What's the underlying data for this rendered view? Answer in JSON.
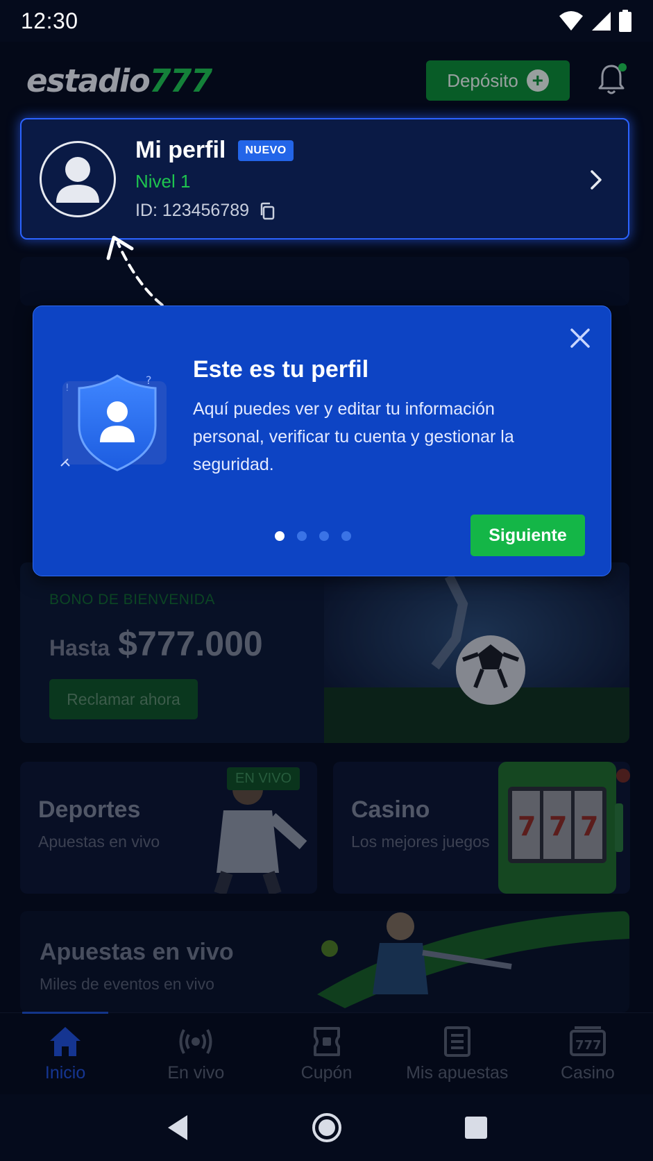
{
  "status_bar": {
    "time": "12:30"
  },
  "header": {
    "logo_text": "estadio",
    "logo_number": "777",
    "deposit_label": "Depósito"
  },
  "profile": {
    "name": "Mi perfil",
    "badge": "NUEVO",
    "level": "Nivel 1",
    "id_text": "ID: 123456789"
  },
  "tooltip": {
    "title": "Este es tu perfil",
    "body": "Aquí puedes ver y editar tu información personal, verificar tu cuenta y gestionar la seguridad.",
    "next_label": "Siguiente",
    "step_count": 4,
    "active_step": 1
  },
  "bono": {
    "label": "BONO DE BIENVENIDA",
    "prefix": "Hasta",
    "amount": "$777.000",
    "cta": "Reclamar ahora"
  },
  "tiles": {
    "sports": {
      "title": "Deportes",
      "subtitle": "Apuestas en vivo",
      "badge": "EN VIVO"
    },
    "casino": {
      "title": "Casino",
      "subtitle": "Los mejores juegos"
    }
  },
  "live_banner": {
    "title": "Apuestas en vivo",
    "subtitle": "Miles de eventos en vivo"
  },
  "bottom_nav": {
    "items": [
      {
        "label": "Inicio",
        "icon": "home-icon",
        "active": true
      },
      {
        "label": "En vivo",
        "icon": "live-broadcast-icon",
        "active": false
      },
      {
        "label": "Cupón",
        "icon": "ticket-icon",
        "active": false
      },
      {
        "label": "Mis apuestas",
        "icon": "bets-list-icon",
        "active": false
      },
      {
        "label": "Casino",
        "icon": "slot-777-icon",
        "active": false
      }
    ]
  },
  "colors": {
    "accent_green": "#1ec44f",
    "accent_blue": "#2365e8",
    "tooltip_bg": "#0d44c4",
    "background": "#050b1c"
  }
}
